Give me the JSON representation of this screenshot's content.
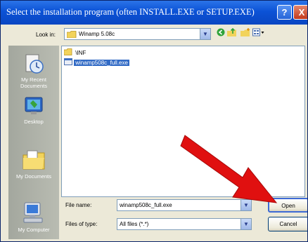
{
  "window": {
    "title": "Select the installation program (often INSTALL.EXE or SETUP.EXE)",
    "help_glyph": "?",
    "close_glyph": "X"
  },
  "toolbar": {
    "lookin_label": "Look in:",
    "lookin_value": "Winamp 5.08c"
  },
  "places": [
    {
      "label": "My Recent Documents",
      "icon": "recent-documents-icon"
    },
    {
      "label": "Desktop",
      "icon": "desktop-icon"
    },
    {
      "label": "My Documents",
      "icon": "my-documents-icon"
    },
    {
      "label": "My Computer",
      "icon": "my-computer-icon"
    }
  ],
  "files": [
    {
      "name": "\\INF",
      "type": "folder",
      "selected": false
    },
    {
      "name": "winamp508c_full.exe",
      "type": "exe",
      "selected": true
    }
  ],
  "filename": {
    "label": "File name:",
    "value": "winamp508c_full.exe"
  },
  "filetype": {
    "label": "Files of type:",
    "value": "All files (*.*)"
  },
  "buttons": {
    "open": "Open",
    "cancel": "Cancel"
  },
  "colors": {
    "titlebar": "#0b52d6",
    "selection": "#316ac5",
    "annotation_arrow": "#e01010"
  }
}
